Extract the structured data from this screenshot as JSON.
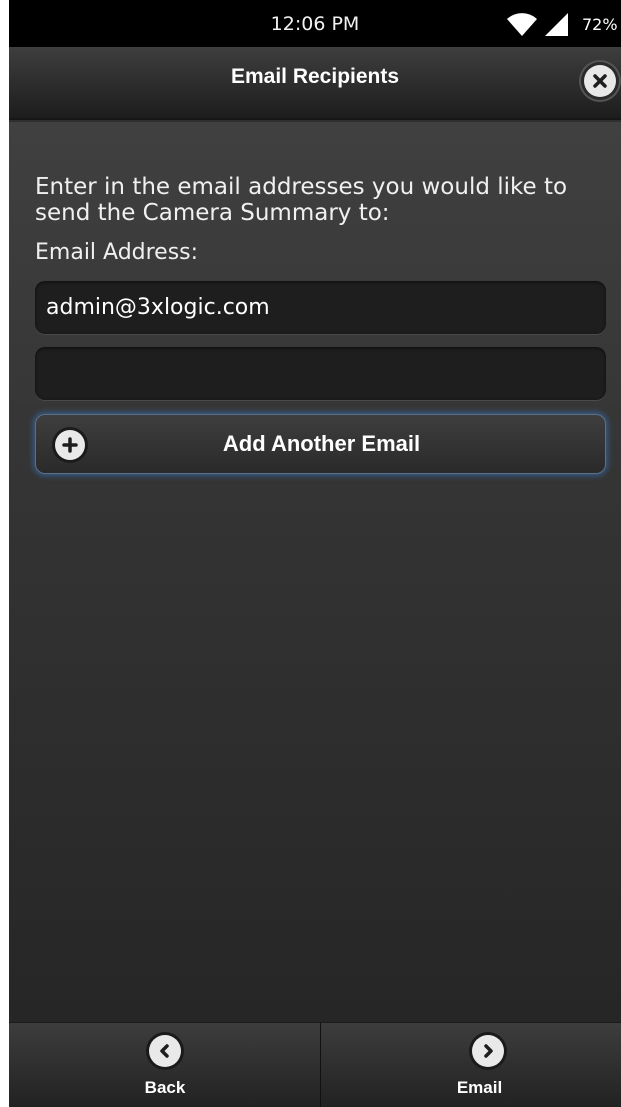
{
  "status_bar": {
    "time": "12:06 PM",
    "battery": "72%",
    "icons": [
      "wifi-icon",
      "signal-icon"
    ]
  },
  "header": {
    "title": "Email Recipients",
    "close_icon": "close-icon"
  },
  "main": {
    "instruction": "Enter in the email addresses you would like to send the Camera Summary to:",
    "email_label": "Email Address:",
    "email_fields": [
      {
        "value": "admin@3xlogic.com",
        "placeholder": ""
      },
      {
        "value": "",
        "placeholder": ""
      }
    ],
    "add_button_label": "Add Another Email",
    "add_icon": "plus-icon"
  },
  "footer": {
    "back_label": "Back",
    "back_icon": "chevron-left-icon",
    "email_label": "Email",
    "email_icon": "chevron-right-icon"
  },
  "colors": {
    "background": "#2f2f2f",
    "field": "#1e1e1e",
    "button_glow": "#3c78c8",
    "text": "#ffffff"
  }
}
